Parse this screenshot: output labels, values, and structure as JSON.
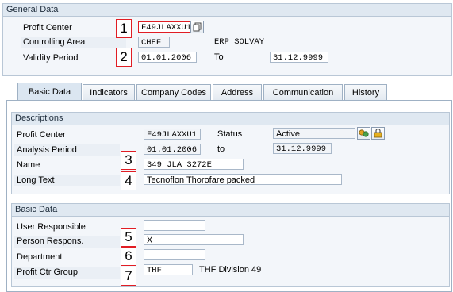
{
  "general": {
    "title": "General Data",
    "profit_center_label": "Profit Center",
    "profit_center_value": "F49JLAXXU1",
    "controlling_area_label": "Controlling Area",
    "controlling_area_value": "CHEF",
    "controlling_area_text": "ERP SOLVAY",
    "validity_label": "Validity Period",
    "validity_from": "01.01.2006",
    "to_label": "To",
    "validity_to": "31.12.9999"
  },
  "tabs": [
    {
      "label": "Basic Data",
      "active": true
    },
    {
      "label": "Indicators"
    },
    {
      "label": "Company Codes"
    },
    {
      "label": "Address"
    },
    {
      "label": "Communication"
    },
    {
      "label": "History"
    }
  ],
  "descriptions": {
    "title": "Descriptions",
    "profit_center_label": "Profit Center",
    "profit_center_value": "F49JLAXXU1",
    "status_label": "Status",
    "status_value": "Active",
    "analysis_label": "Analysis Period",
    "analysis_from": "01.01.2006",
    "to_label": "to",
    "analysis_to": "31.12.9999",
    "name_label": "Name",
    "name_value": "349 JLA 3272E",
    "long_text_label": "Long Text",
    "long_text_value": "Tecnoflon Thorofare packed"
  },
  "basic": {
    "title": "Basic Data",
    "user_resp_label": "User Responsible",
    "user_resp_value": "",
    "person_resp_label": "Person Respons.",
    "person_resp_value": "X",
    "department_label": "Department",
    "department_value": "",
    "group_label": "Profit Ctr Group",
    "group_value": "THF",
    "group_text": "THF Division 49"
  },
  "markers": [
    "1",
    "2",
    "3",
    "4",
    "5",
    "6",
    "7"
  ],
  "icons": {
    "matchcode": "copy-icon",
    "status_a": "activate-icon",
    "status_b": "lock-icon"
  },
  "colors": {
    "marker_border": "#e11d24",
    "group_header": "#dfe8f1"
  }
}
